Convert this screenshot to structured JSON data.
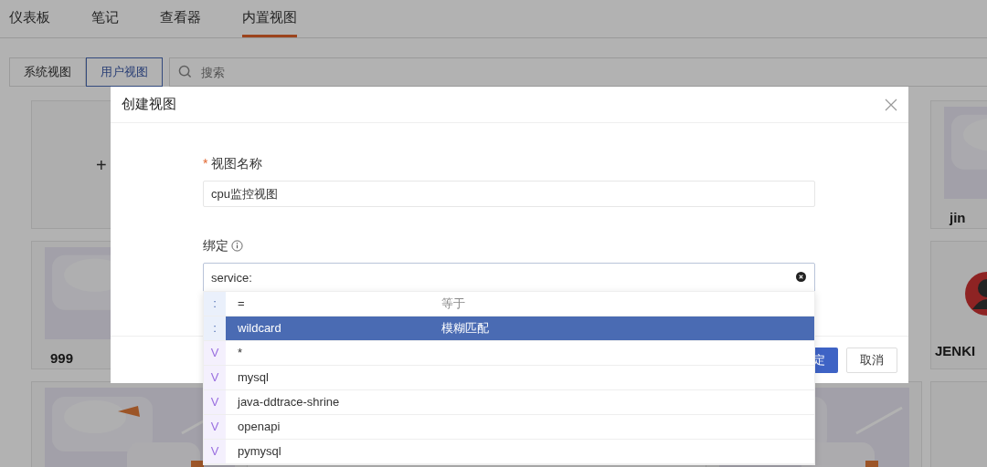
{
  "tabs": [
    {
      "label": "仪表板",
      "selected": false
    },
    {
      "label": "笔记",
      "selected": false
    },
    {
      "label": "查看器",
      "selected": false
    },
    {
      "label": "内置视图",
      "selected": true
    }
  ],
  "view_toggle": [
    {
      "label": "系统视图",
      "selected": false
    },
    {
      "label": "用户视图",
      "selected": true
    }
  ],
  "search": {
    "placeholder": "搜索"
  },
  "cards": [
    {
      "kind": "add",
      "title": "+"
    },
    {
      "kind": "picture",
      "title": "jin"
    },
    {
      "kind": "picture",
      "title": "999"
    },
    {
      "kind": "avatar",
      "title": "JENKI"
    },
    {
      "kind": "picture"
    },
    {
      "kind": "picture"
    },
    {
      "kind": "empty"
    }
  ],
  "dialog": {
    "title": "创建视图",
    "name_field": {
      "label": "视图名称",
      "required": true,
      "value": "cpu监控视图"
    },
    "binding_field": {
      "label": "绑定",
      "value": "service:"
    },
    "buttons": [
      {
        "label": "定",
        "kind": "primary"
      },
      {
        "label": "取消",
        "kind": "default"
      }
    ]
  },
  "suggestions": [
    {
      "kind": "operator",
      "prefix": ":",
      "value": "=",
      "description": "等于",
      "selected": false
    },
    {
      "kind": "operator",
      "prefix": ":",
      "value": "wildcard",
      "description": "模糊匹配",
      "selected": true
    },
    {
      "kind": "value",
      "prefix": "V",
      "value": "*",
      "selected": false
    },
    {
      "kind": "value",
      "prefix": "V",
      "value": "mysql",
      "selected": false
    },
    {
      "kind": "value",
      "prefix": "V",
      "value": "java-ddtrace-shrine",
      "selected": false
    },
    {
      "kind": "value",
      "prefix": "V",
      "value": "openapi",
      "selected": false
    },
    {
      "kind": "value",
      "prefix": "V",
      "value": "pymysql",
      "selected": false
    }
  ]
}
